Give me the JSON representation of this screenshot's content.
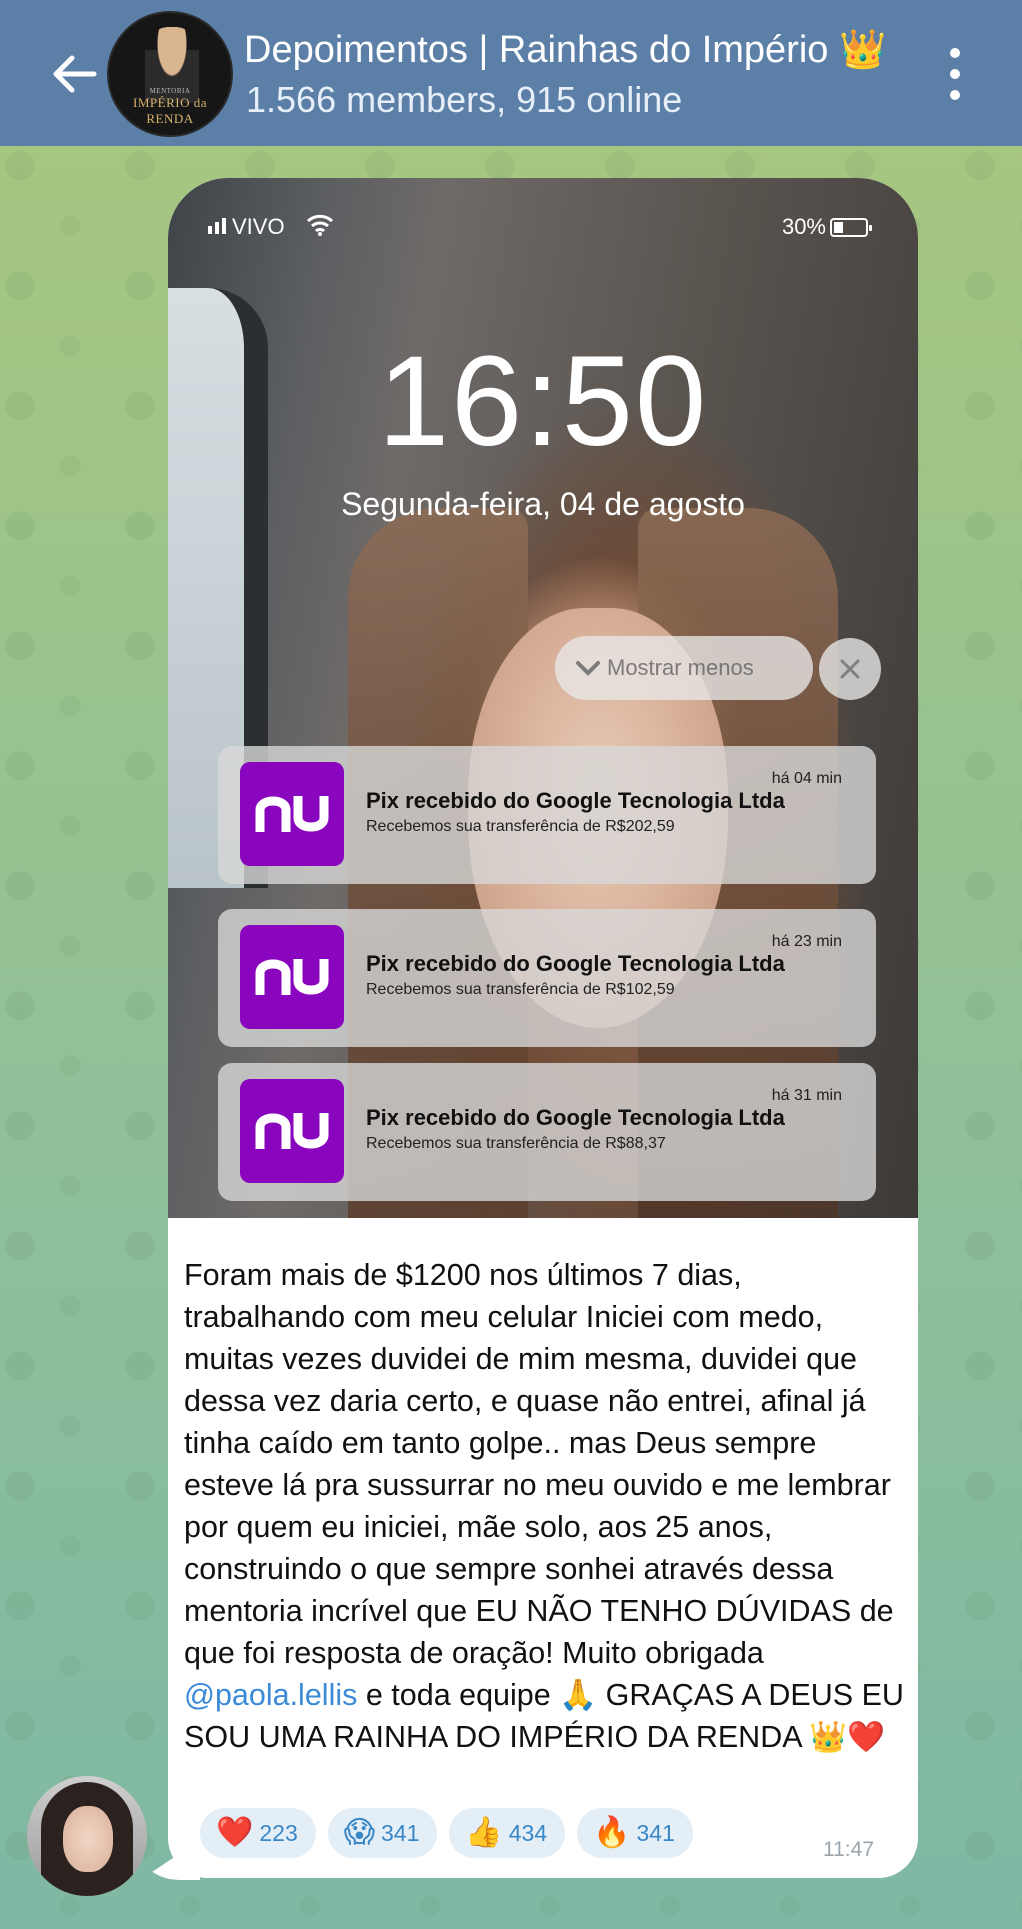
{
  "header": {
    "title": "Depoimentos | Rainhas do Império 👑",
    "subtitle": "1.566 members, 915 online",
    "avatar_brand_top": "MENTORIA",
    "avatar_brand": "IMPÉRIO da RENDA"
  },
  "lockscreen": {
    "carrier": "VIVO",
    "battery": "30%",
    "time": "16:50",
    "date": "Segunda-feira, 04 de agosto",
    "show_less": "Mostrar menos"
  },
  "notifications": [
    {
      "time": "há 04 min",
      "title": "Pix recebido do Google Tecnologia Ltda",
      "body": "Recebemos sua transferência de R$202,59"
    },
    {
      "time": "há 23 min",
      "title": "Pix recebido do Google Tecnologia Ltda",
      "body": "Recebemos sua transferência de R$102,59"
    },
    {
      "time": "há 31 min",
      "title": "Pix recebido do Google Tecnologia Ltda",
      "body": "Recebemos sua transferência de R$88,37"
    }
  ],
  "message": {
    "text_before": "Foram mais de $1200 nos últimos 7 dias, trabalhando com meu celular Iniciei com medo, muitas vezes duvidei de mim mesma, duvidei que dessa vez daria certo, e quase não entrei, afinal já tinha caído em tanto golpe.. mas Deus sempre esteve lá pra sussurrar no meu ouvido e me lembrar por quem eu iniciei, mãe solo, aos 25 anos, construindo o que sempre sonhei através dessa mentoria incrível que EU NÃO TENHO DÚVIDAS de que foi resposta de oração! Muito obrigada ",
    "mention": "@paola.lellis",
    "text_after": " e toda equipe 🙏 GRAÇAS A DEUS EU SOU UMA RAINHA DO IMPÉRIO DA RENDA 👑❤️",
    "time": "11:47",
    "reactions": [
      {
        "emoji": "❤️",
        "count": "223"
      },
      {
        "emoji": "😱",
        "count": "341"
      },
      {
        "emoji": "👍",
        "count": "434"
      },
      {
        "emoji": "🔥",
        "count": "341"
      }
    ]
  },
  "colors": {
    "header_bg": "#5b7fa7",
    "nubank_purple": "#8a05be",
    "mention_blue": "#3a8ad8",
    "reaction_bg": "#e4eef6"
  }
}
